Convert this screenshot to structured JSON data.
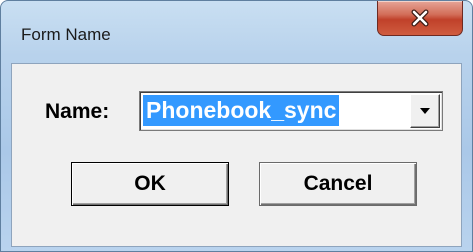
{
  "window": {
    "title": "Form Name",
    "close_icon": "close-icon"
  },
  "form": {
    "name_label": "Name:",
    "name_value": "Phonebook_sync",
    "dropdown_icon": "chevron-down-icon"
  },
  "buttons": {
    "ok_label": "OK",
    "cancel_label": "Cancel"
  },
  "colors": {
    "selection_bg": "#3399ff",
    "close_button": "#c0412a"
  }
}
